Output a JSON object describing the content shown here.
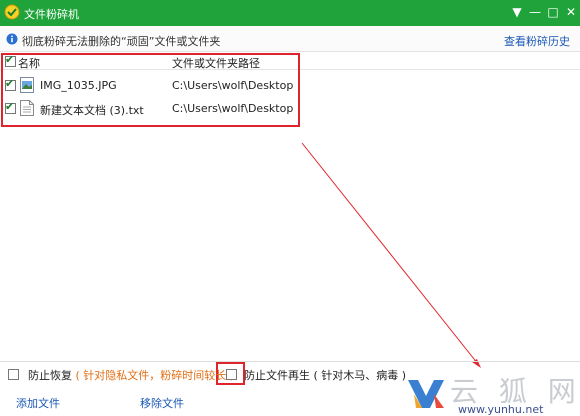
{
  "window": {
    "title": "文件粉碎机",
    "controls": {
      "menu": "▼",
      "minimize": "—",
      "maximize": "□",
      "close": "✕"
    }
  },
  "info_bar": {
    "text": "彻底粉碎无法删除的“顽固”文件或文件夹",
    "history_link": "查看粉碎历史"
  },
  "file_list": {
    "columns": [
      "名称",
      "文件或文件夹路径"
    ],
    "rows": [
      {
        "name": "IMG_1035.JPG",
        "path": "C:\\Users\\wolf\\Desktop",
        "checked": true,
        "icon": "image-file-icon"
      },
      {
        "name": "新建文本文档 (3).txt",
        "path": "C:\\Users\\wolf\\Desktop",
        "checked": true,
        "icon": "text-file-icon"
      }
    ]
  },
  "options": {
    "prevent_recovery": "防止恢复",
    "prevent_recovery_hint": "( 针对隐私文件，粉碎时间较长 )",
    "prevent_regeneration": "防止文件再生",
    "prevent_regeneration_hint": "( 针对木马、病毒 )"
  },
  "actions": {
    "add_file": "添加文件",
    "remove_file": "移除文件"
  },
  "watermark": {
    "text": "云 狐 网",
    "url": "www.yunhu.net"
  },
  "colors": {
    "titlebar": "#1fa33a",
    "link": "#1a57b6",
    "annotation": "#e0242e",
    "hint": "#e06d12"
  }
}
